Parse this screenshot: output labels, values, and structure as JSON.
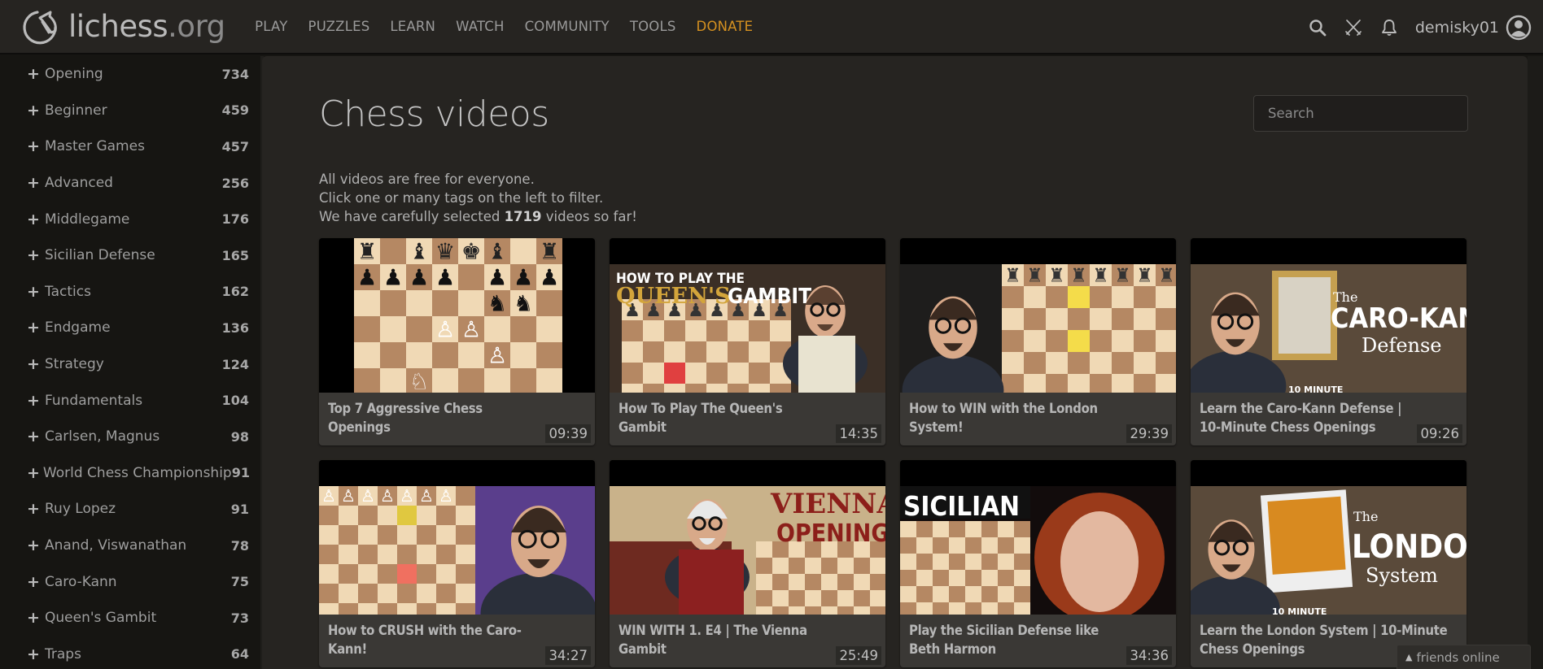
{
  "header": {
    "logo_text": "lichess",
    "logo_tld": ".org",
    "nav": [
      {
        "label": "PLAY"
      },
      {
        "label": "PUZZLES"
      },
      {
        "label": "LEARN"
      },
      {
        "label": "WATCH"
      },
      {
        "label": "COMMUNITY"
      },
      {
        "label": "TOOLS"
      },
      {
        "label": "DONATE"
      }
    ],
    "icons": [
      "search-icon",
      "swords-icon",
      "bell-icon"
    ],
    "username": "demisky01",
    "colors": {
      "donate": "#d59120",
      "background": "#262421"
    }
  },
  "sidebar": {
    "tags": [
      {
        "label": "Opening",
        "count": "734"
      },
      {
        "label": "Beginner",
        "count": "459"
      },
      {
        "label": "Master Games",
        "count": "457"
      },
      {
        "label": "Advanced",
        "count": "256"
      },
      {
        "label": "Middlegame",
        "count": "176"
      },
      {
        "label": "Sicilian Defense",
        "count": "165"
      },
      {
        "label": "Tactics",
        "count": "162"
      },
      {
        "label": "Endgame",
        "count": "136"
      },
      {
        "label": "Strategy",
        "count": "124"
      },
      {
        "label": "Fundamentals",
        "count": "104"
      },
      {
        "label": "Carlsen, Magnus",
        "count": "98"
      },
      {
        "label": "World Chess Championship",
        "count": "91"
      },
      {
        "label": "Ruy Lopez",
        "count": "91"
      },
      {
        "label": "Anand, Viswanathan",
        "count": "78"
      },
      {
        "label": "Caro-Kann",
        "count": "75"
      },
      {
        "label": "Queen's Gambit",
        "count": "73"
      },
      {
        "label": "Traps",
        "count": "64"
      }
    ],
    "plus_symbol": "+"
  },
  "main": {
    "title": "Chess videos",
    "search_placeholder": "Search",
    "intro": {
      "line1": "All videos are free for everyone.",
      "line2": "Click one or many tags on the left to filter.",
      "line3_prefix": "We have carefully selected ",
      "line3_count": "1719",
      "line3_suffix": " videos so far!"
    },
    "videos": [
      {
        "title": "Top 7 Aggressive Chess Openings",
        "duration": "09:39",
        "thumb": "board-only"
      },
      {
        "title": "How To Play The Queen's Gambit",
        "duration": "14:35",
        "thumb": "queens-gambit",
        "thumb_text": [
          "HOW TO PLAY THE",
          "QUEEN'S",
          "GAMBIT"
        ]
      },
      {
        "title": "How to WIN with the London System!",
        "duration": "29:39",
        "thumb": "london-win"
      },
      {
        "title": "Learn the Caro-Kann Defense | 10-Minute Chess Openings",
        "duration": "09:26",
        "thumb": "caro-kann-10",
        "thumb_text": [
          "The",
          "CARO-KANN",
          "Defense",
          "10 MINUTE"
        ]
      },
      {
        "title": "How to CRUSH with the Caro-Kann!",
        "duration": "34:27",
        "thumb": "caro-crush"
      },
      {
        "title": "WIN WITH 1. E4 | The Vienna Gambit",
        "duration": "25:49",
        "thumb": "vienna",
        "thumb_text": [
          "VIENNA",
          "OPENING"
        ]
      },
      {
        "title": "Play the Sicilian Defense like Beth Harmon",
        "duration": "34:36",
        "thumb": "sicilian",
        "thumb_text": [
          "SICILIAN"
        ]
      },
      {
        "title": "Learn the London System | 10-Minute Chess Openings",
        "duration": "",
        "thumb": "london-10",
        "thumb_text": [
          "The",
          "LONDON",
          "System",
          "10 MINUTE"
        ]
      }
    ]
  },
  "friends_widget": {
    "label": "friends online",
    "caret": "▲"
  }
}
